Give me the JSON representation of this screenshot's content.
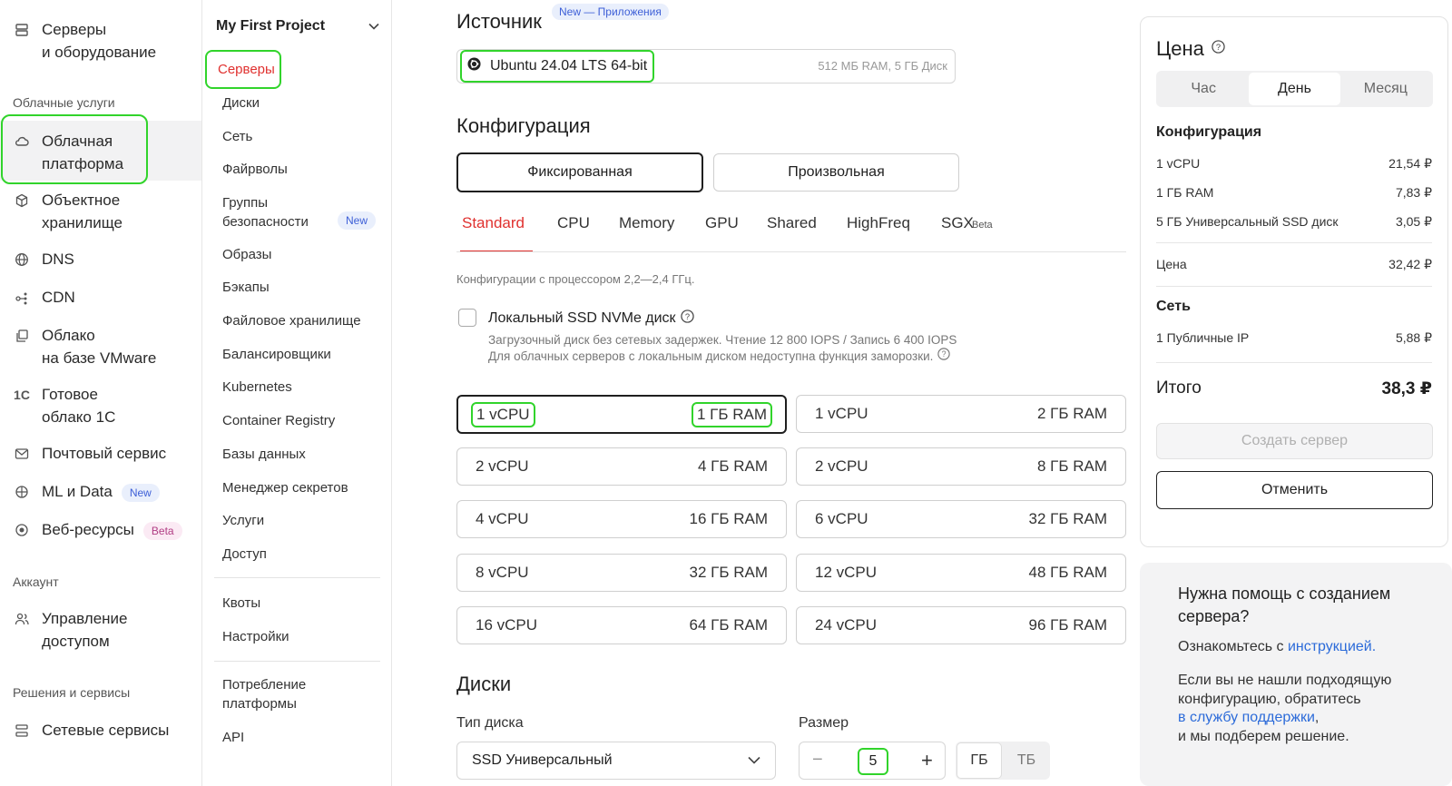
{
  "nav": {
    "items_top": [
      {
        "label": "Серверы\nи оборудование",
        "icon": "server-icon"
      }
    ],
    "section_cloud": "Облачные услуги",
    "cloud_items": [
      {
        "label": "Облачная\nплатформа",
        "icon": "cloud-icon"
      },
      {
        "label": "Объектное\nхранилище",
        "icon": "cube-icon"
      },
      {
        "label": "DNS",
        "icon": "globe-icon"
      },
      {
        "label": "CDN",
        "icon": "cdn-icon"
      },
      {
        "label": "Облако\nна базе VMware",
        "icon": "copy-icon"
      },
      {
        "label": "Готовое\nоблако 1С",
        "icon": "1c-icon"
      },
      {
        "label": "Почтовый сервис",
        "icon": "mail-icon"
      },
      {
        "label": "ML и Data",
        "icon": "ml-icon",
        "badge": "New"
      },
      {
        "label": "Веб-ресурсы",
        "icon": "web-icon",
        "badge": "Beta"
      }
    ],
    "section_account": "Аккаунт",
    "account_items": [
      {
        "label": "Управление\nдоступом",
        "icon": "users-icon"
      }
    ],
    "section_solutions": "Решения и сервисы",
    "solutions_items": [
      {
        "label": "Сетевые сервисы",
        "icon": "network-icon"
      }
    ]
  },
  "subnav": {
    "project": "My First Project",
    "items": [
      "Серверы",
      "Диски",
      "Сеть",
      "Файрволы",
      "Группы\nбезопасности",
      "Образы",
      "Бэкапы",
      "Файловое хранилище",
      "Балансировщики",
      "Kubernetes",
      "Container Registry",
      "Базы данных",
      "Менеджер секретов",
      "Услуги",
      "Доступ"
    ],
    "security_badge": "New",
    "items2": [
      "Квоты",
      "Настройки"
    ],
    "items3": [
      "Потребление\nплатформы",
      "API"
    ]
  },
  "source": {
    "title": "Источник",
    "badge": "New — Приложения",
    "os": "Ubuntu 24.04 LTS 64-bit",
    "os_req": "512 МБ RAM, 5 ГБ Диск"
  },
  "config": {
    "title": "Конфигурация",
    "mode_fixed": "Фиксированная",
    "mode_custom": "Произвольная",
    "tabs": [
      "Standard",
      "CPU",
      "Memory",
      "GPU",
      "Shared",
      "HighFreq",
      "SGX"
    ],
    "tab_beta": "Beta",
    "desc": "Конфигурации с процессором 2,2—2,4 ГГц.",
    "nvme_label": "Локальный SSD NVMe диск",
    "nvme_desc1": "Загрузочный диск без сетевых задержек. Чтение 12 800 IOPS / Запись 6 400 IOPS",
    "nvme_desc2": "Для облачных серверов с локальным диском недоступна функция заморозки.",
    "presets": [
      {
        "cpu": "1 vCPU",
        "ram": "1 ГБ RAM"
      },
      {
        "cpu": "1 vCPU",
        "ram": "2 ГБ RAM"
      },
      {
        "cpu": "2 vCPU",
        "ram": "4 ГБ RAM"
      },
      {
        "cpu": "2 vCPU",
        "ram": "8 ГБ RAM"
      },
      {
        "cpu": "4 vCPU",
        "ram": "16 ГБ RAM"
      },
      {
        "cpu": "6 vCPU",
        "ram": "32 ГБ RAM"
      },
      {
        "cpu": "8 vCPU",
        "ram": "32 ГБ RAM"
      },
      {
        "cpu": "12 vCPU",
        "ram": "48 ГБ RAM"
      },
      {
        "cpu": "16 vCPU",
        "ram": "64 ГБ RAM"
      },
      {
        "cpu": "24 vCPU",
        "ram": "96 ГБ RAM"
      }
    ]
  },
  "disks": {
    "title": "Диски",
    "type_label": "Тип диска",
    "type_value": "SSD Универсальный",
    "size_label": "Размер",
    "size_value": "5",
    "unit_gb": "ГБ",
    "unit_tb": "ТБ"
  },
  "price": {
    "title": "Цена",
    "periods": [
      "Час",
      "День",
      "Месяц"
    ],
    "config_title": "Конфигурация",
    "lines": [
      {
        "name": "1 vCPU",
        "value": "21,54 ₽"
      },
      {
        "name": "1 ГБ RAM",
        "value": "7,83 ₽"
      },
      {
        "name": "5 ГБ Универсальный SSD диск",
        "value": "3,05 ₽"
      }
    ],
    "subtotal_label": "Цена",
    "subtotal": "32,42 ₽",
    "net_title": "Сеть",
    "net_line": {
      "name": "1 Публичные IP",
      "value": "5,88 ₽"
    },
    "total_label": "Итого",
    "total": "38,3 ₽",
    "create_btn": "Создать сервер",
    "cancel_btn": "Отменить"
  },
  "help": {
    "title": "Нужна помощь с созданием сервера?",
    "line1": "Ознакомьтесь с ",
    "link1": "инструкцией.",
    "line2": "Если вы не нашли подходящую конфигурацию, обратитесь",
    "link2": "в службу поддержки",
    "line3": ",",
    "line4": "и мы подберем решение."
  },
  "colors": {
    "accent_red": "#e0312f",
    "link_blue": "#2c6bd9",
    "highlight_green": "#31d42b"
  }
}
